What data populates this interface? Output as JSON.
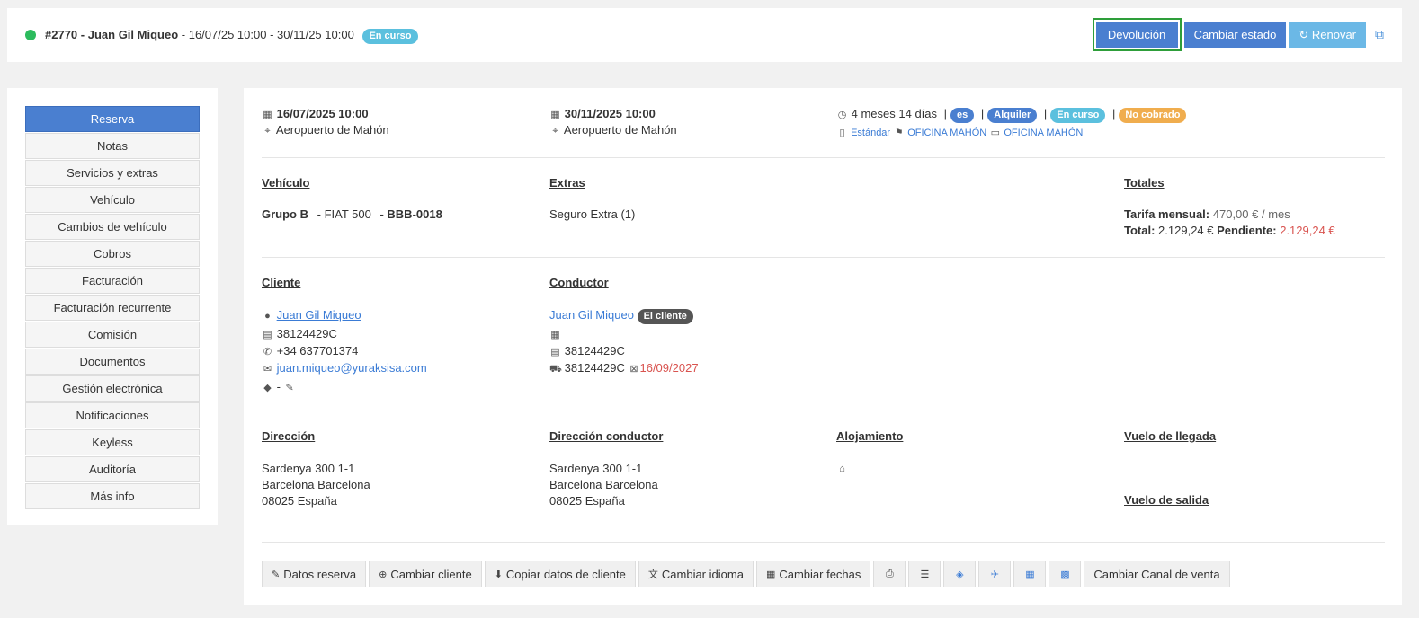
{
  "header": {
    "reservation_id": "#2770",
    "client_name": "Juan Gil Miqueo",
    "date_range": "16/07/25 10:00 - 30/11/25 10:00",
    "status_badge": "En curso",
    "buttons": {
      "devolucion": "Devolución",
      "cambiar_estado": "Cambiar estado",
      "renovar": "Renovar"
    }
  },
  "sidebar": {
    "items": [
      {
        "label": "Reserva",
        "active": true
      },
      {
        "label": "Notas"
      },
      {
        "label": "Servicios y extras"
      },
      {
        "label": "Vehículo"
      },
      {
        "label": "Cambios de vehículo"
      },
      {
        "label": "Cobros"
      },
      {
        "label": "Facturación"
      },
      {
        "label": "Facturación recurrente"
      },
      {
        "label": "Comisión"
      },
      {
        "label": "Documentos"
      },
      {
        "label": "Gestión electrónica"
      },
      {
        "label": "Notificaciones"
      },
      {
        "label": "Keyless"
      },
      {
        "label": "Auditoría"
      },
      {
        "label": "Más info"
      }
    ]
  },
  "summary": {
    "pickup_datetime": "16/07/2025 10:00",
    "pickup_location": "Aeropuerto de Mahón",
    "return_datetime": "30/11/2025 10:00",
    "return_location": "Aeropuerto de Mahón",
    "duration": "4 meses 14 días",
    "badge_lang": "es",
    "badge_type": "Alquiler",
    "badge_status": "En curso",
    "badge_payment": "No cobrado",
    "tariff": "Estándar",
    "office_pickup": "OFICINA MAHÓN",
    "office_return": "OFICINA MAHÓN"
  },
  "vehicle": {
    "heading": "Vehículo",
    "group": "Grupo B",
    "model": "- FIAT 500",
    "plate": "- BBB-0018"
  },
  "extras": {
    "heading": "Extras",
    "item": "Seguro Extra (1)"
  },
  "totals": {
    "heading": "Totales",
    "tariff_label": "Tarifa mensual:",
    "tariff_value": "470,00 € / mes",
    "total_label": "Total:",
    "total_value": "2.129,24 €",
    "pending_label": "Pendiente:",
    "pending_value": "2.129,24 €"
  },
  "client": {
    "heading": "Cliente",
    "name": "Juan Gil Miqueo",
    "id_doc": "38124429C",
    "phone": "+34 637701374",
    "email": "juan.miqueo@yuraksisa.com",
    "tags": "-"
  },
  "driver": {
    "heading": "Conductor",
    "name": "Juan Gil Miqueo",
    "badge": "El cliente",
    "id_doc": "38124429C",
    "license": "38124429C",
    "license_expiry": "16/09/2027"
  },
  "address": {
    "heading": "Dirección",
    "line1": "Sardenya 300 1-1",
    "line2": "Barcelona Barcelona",
    "line3": "08025 España"
  },
  "driver_address": {
    "heading": "Dirección conductor",
    "line1": "Sardenya 300 1-1",
    "line2": "Barcelona Barcelona",
    "line3": "08025 España"
  },
  "accommodation": {
    "heading": "Alojamiento"
  },
  "flights": {
    "arrival_heading": "Vuelo de llegada",
    "departure_heading": "Vuelo de salida"
  },
  "actions": {
    "datos_reserva": "Datos reserva",
    "cambiar_cliente": "Cambiar cliente",
    "copiar_datos": "Copiar datos de cliente",
    "cambiar_idioma": "Cambiar idioma",
    "cambiar_fechas": "Cambiar fechas",
    "cambiar_canal": "Cambiar Canal de venta"
  },
  "colors": {
    "primary": "#4a7fd0",
    "info": "#6bb8e6",
    "status_green": "#2cbb5d",
    "warning": "#f0ad4e",
    "danger": "#d9534f",
    "focus_outline": "#2e9e3a"
  }
}
